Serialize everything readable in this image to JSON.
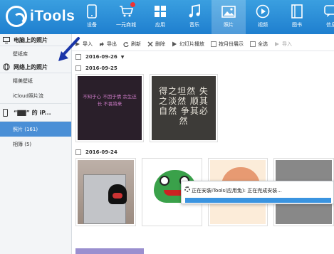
{
  "app": {
    "name": "iTools",
    "accent": "#2489d8"
  },
  "nav": [
    {
      "label": "设备",
      "icon": "phone-icon"
    },
    {
      "label": "一元商城",
      "icon": "cart-icon",
      "badge": true
    },
    {
      "label": "应用",
      "icon": "apps-icon"
    },
    {
      "label": "音乐",
      "icon": "music-icon"
    },
    {
      "label": "照片",
      "icon": "photo-icon",
      "active": true
    },
    {
      "label": "视频",
      "icon": "video-icon"
    },
    {
      "label": "图书",
      "icon": "book-icon"
    },
    {
      "label": "信息",
      "icon": "message-icon"
    }
  ],
  "sidebar": {
    "pc_section": "电脑上的照片",
    "pc_items": [
      "壁纸库"
    ],
    "net_section": "网络上的照片",
    "net_items": [
      "精美壁纸",
      "iCloud照片流"
    ],
    "device": "“▇▇” 的 iP...",
    "device_items": [
      {
        "label": "照片 (161)",
        "active": true
      },
      {
        "label": "相簿 (5)"
      }
    ]
  },
  "toolbar": {
    "import": "导入",
    "export": "导出",
    "refresh": "刷新",
    "delete": "删除",
    "slideshow": "幻灯片播放",
    "by_backup": "按月份展示",
    "select_all": "全选",
    "import_to": "导入"
  },
  "content": {
    "date_group_top": "2016-09-26",
    "date1": "2016-09-25",
    "date2": "2016-09-24",
    "thumb1_text": "不知于心 不因于情 余生还长 不畏将来",
    "thumb2_text": "得之坦然 失之淡然 顺其自然 争其必然"
  },
  "dialog": {
    "text": "正在安装iTools(应用兔): 正在完成安装...",
    "progress": 1.0
  }
}
